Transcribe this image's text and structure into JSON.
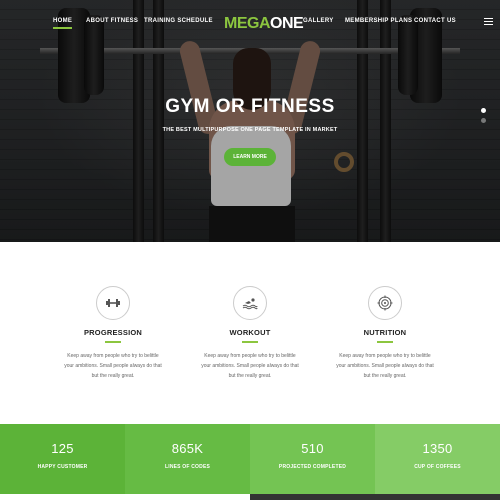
{
  "nav": {
    "links": [
      "HOME",
      "ABOUT FITNESS",
      "TRAINING SCHEDULE",
      "GALLERY",
      "MEMBERSHIP PLANS",
      "CONTACT US"
    ],
    "logo_green": "MEGA",
    "logo_white": "ONE"
  },
  "hero": {
    "title": "GYM OR FITNESS",
    "subtitle": "THE BEST MULTIPURPOSE ONE PAGE TEMPLATE IN MARKET",
    "button": "LEARN MORE",
    "slide_count": 2,
    "active_slide": 1
  },
  "features": [
    {
      "title": "PROGRESSION",
      "icon": "dumbbell-icon",
      "lines": [
        "Keep away from people who try to belittle",
        "your ambitions. Small people always do that",
        "but the really great."
      ]
    },
    {
      "title": "WORKOUT",
      "icon": "swimmer-icon",
      "lines": [
        "Keep away from people who try to belittle",
        "your ambitions. Small people always do that",
        "but the really great."
      ]
    },
    {
      "title": "NUTRITION",
      "icon": "target-icon",
      "lines": [
        "Keep away from people who try to belittle",
        "your ambitions. Small people always do that",
        "but the really great."
      ]
    }
  ],
  "stats": [
    {
      "number": "125",
      "label": "HAPPY CUSTOMER",
      "color": "#5cb338"
    },
    {
      "number": "865K",
      "label": "LINES OF CODES",
      "color": "#66bb44"
    },
    {
      "number": "510",
      "label": "PROJECTED COMPLETED",
      "color": "#74c453"
    },
    {
      "number": "1350",
      "label": "CUP OF COFFEES",
      "color": "#85cc66"
    }
  ],
  "colors": {
    "accent": "#8cc63f",
    "button": "#5cb338"
  }
}
